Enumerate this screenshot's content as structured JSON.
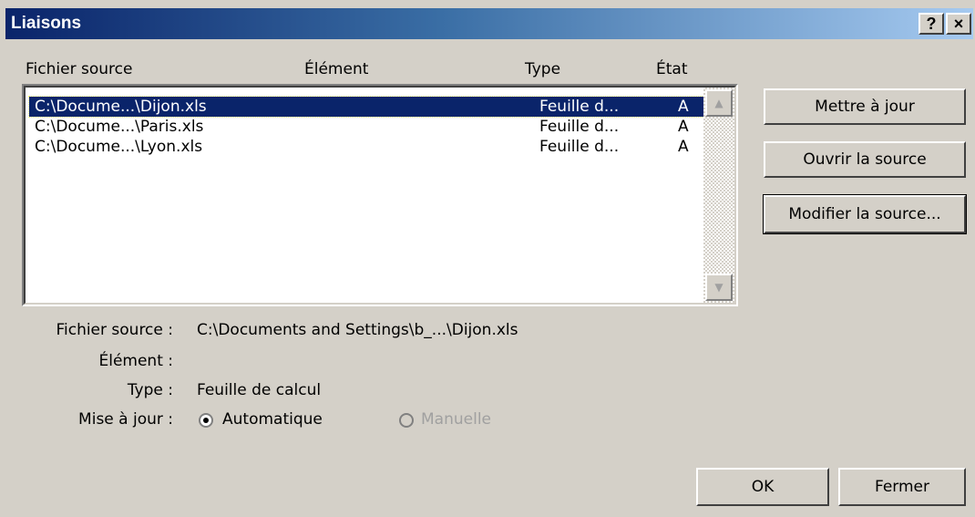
{
  "window": {
    "title": "Liaisons",
    "help_label": "?",
    "close_label": "×"
  },
  "list": {
    "columns": {
      "source": "Fichier source",
      "element": "Élément",
      "type": "Type",
      "state": "État"
    },
    "rows": [
      {
        "source": "C:\\Docume...\\Dijon.xls",
        "element": "",
        "type": "Feuille d...",
        "state": "A"
      },
      {
        "source": "C:\\Docume...\\Paris.xls",
        "element": "",
        "type": "Feuille d...",
        "state": "A"
      },
      {
        "source": "C:\\Docume...\\Lyon.xls",
        "element": "",
        "type": "Feuille d...",
        "state": "A"
      }
    ],
    "selected_index": 0
  },
  "actions": {
    "update": "Mettre à jour",
    "open_source": "Ouvrir la source",
    "change_source": "Modifier la source..."
  },
  "details": {
    "source_label": "Fichier source :",
    "source_value": "C:\\Documents and Settings\\b_...\\Dijon.xls",
    "element_label": "Élément :",
    "element_value": "",
    "type_label": "Type :",
    "type_value": "Feuille de calcul",
    "update_label": "Mise à jour :",
    "auto_label": "Automatique",
    "manual_label": "Manuelle"
  },
  "footer": {
    "ok": "OK",
    "close": "Fermer"
  }
}
